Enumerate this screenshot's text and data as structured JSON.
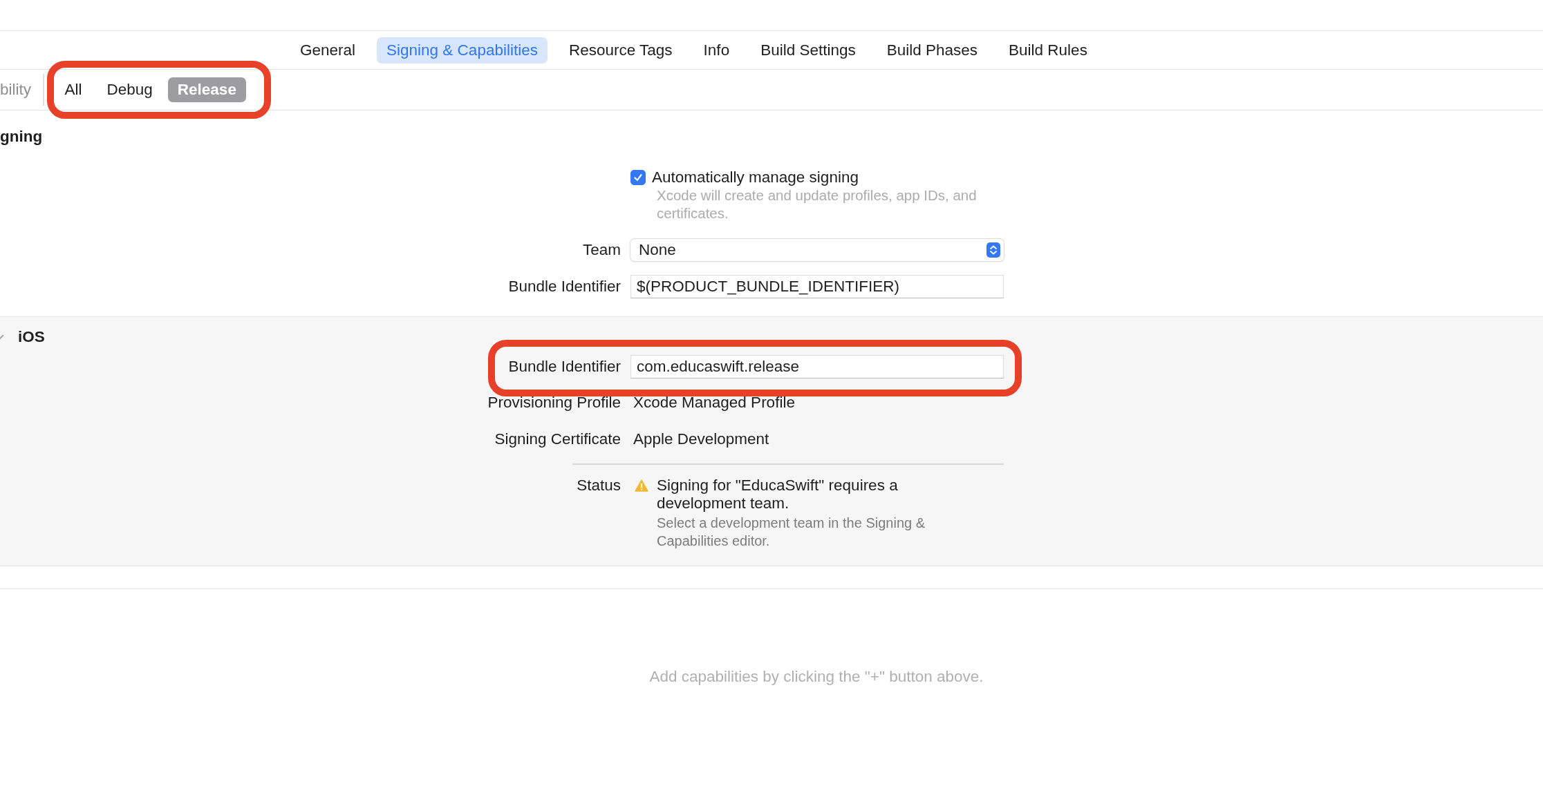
{
  "tabs": [
    {
      "label": "General",
      "selected": false
    },
    {
      "label": "Signing & Capabilities",
      "selected": true
    },
    {
      "label": "Resource Tags",
      "selected": false
    },
    {
      "label": "Info",
      "selected": false
    },
    {
      "label": "Build Settings",
      "selected": false
    },
    {
      "label": "Build Phases",
      "selected": false
    },
    {
      "label": "Build Rules",
      "selected": false
    }
  ],
  "configurations": {
    "partial_label": "bility",
    "items": [
      {
        "label": "All",
        "selected": false
      },
      {
        "label": "Debug",
        "selected": false
      },
      {
        "label": "Release",
        "selected": true
      }
    ]
  },
  "signing": {
    "title": "gning",
    "auto_manage": {
      "label": "Automatically manage signing",
      "checked": true,
      "description": "Xcode will create and update profiles, app IDs, and certificates."
    },
    "team": {
      "label": "Team",
      "value": "None"
    },
    "bundle_identifier": {
      "label": "Bundle Identifier",
      "value": "$(PRODUCT_BUNDLE_IDENTIFIER)"
    }
  },
  "ios": {
    "title": "iOS",
    "bundle_identifier": {
      "label": "Bundle Identifier",
      "value": "com.educaswift.release"
    },
    "provisioning_profile": {
      "label": "Provisioning Profile",
      "value": "Xcode Managed Profile"
    },
    "signing_certificate": {
      "label": "Signing Certificate",
      "value": "Apple Development"
    },
    "status": {
      "label": "Status",
      "message": "Signing for \"EducaSwift\" requires a development team.",
      "detail": "Select a development team in the Signing & Capabilities editor."
    }
  },
  "capabilities_hint": "Add capabilities by clicking the \"+\" button above."
}
